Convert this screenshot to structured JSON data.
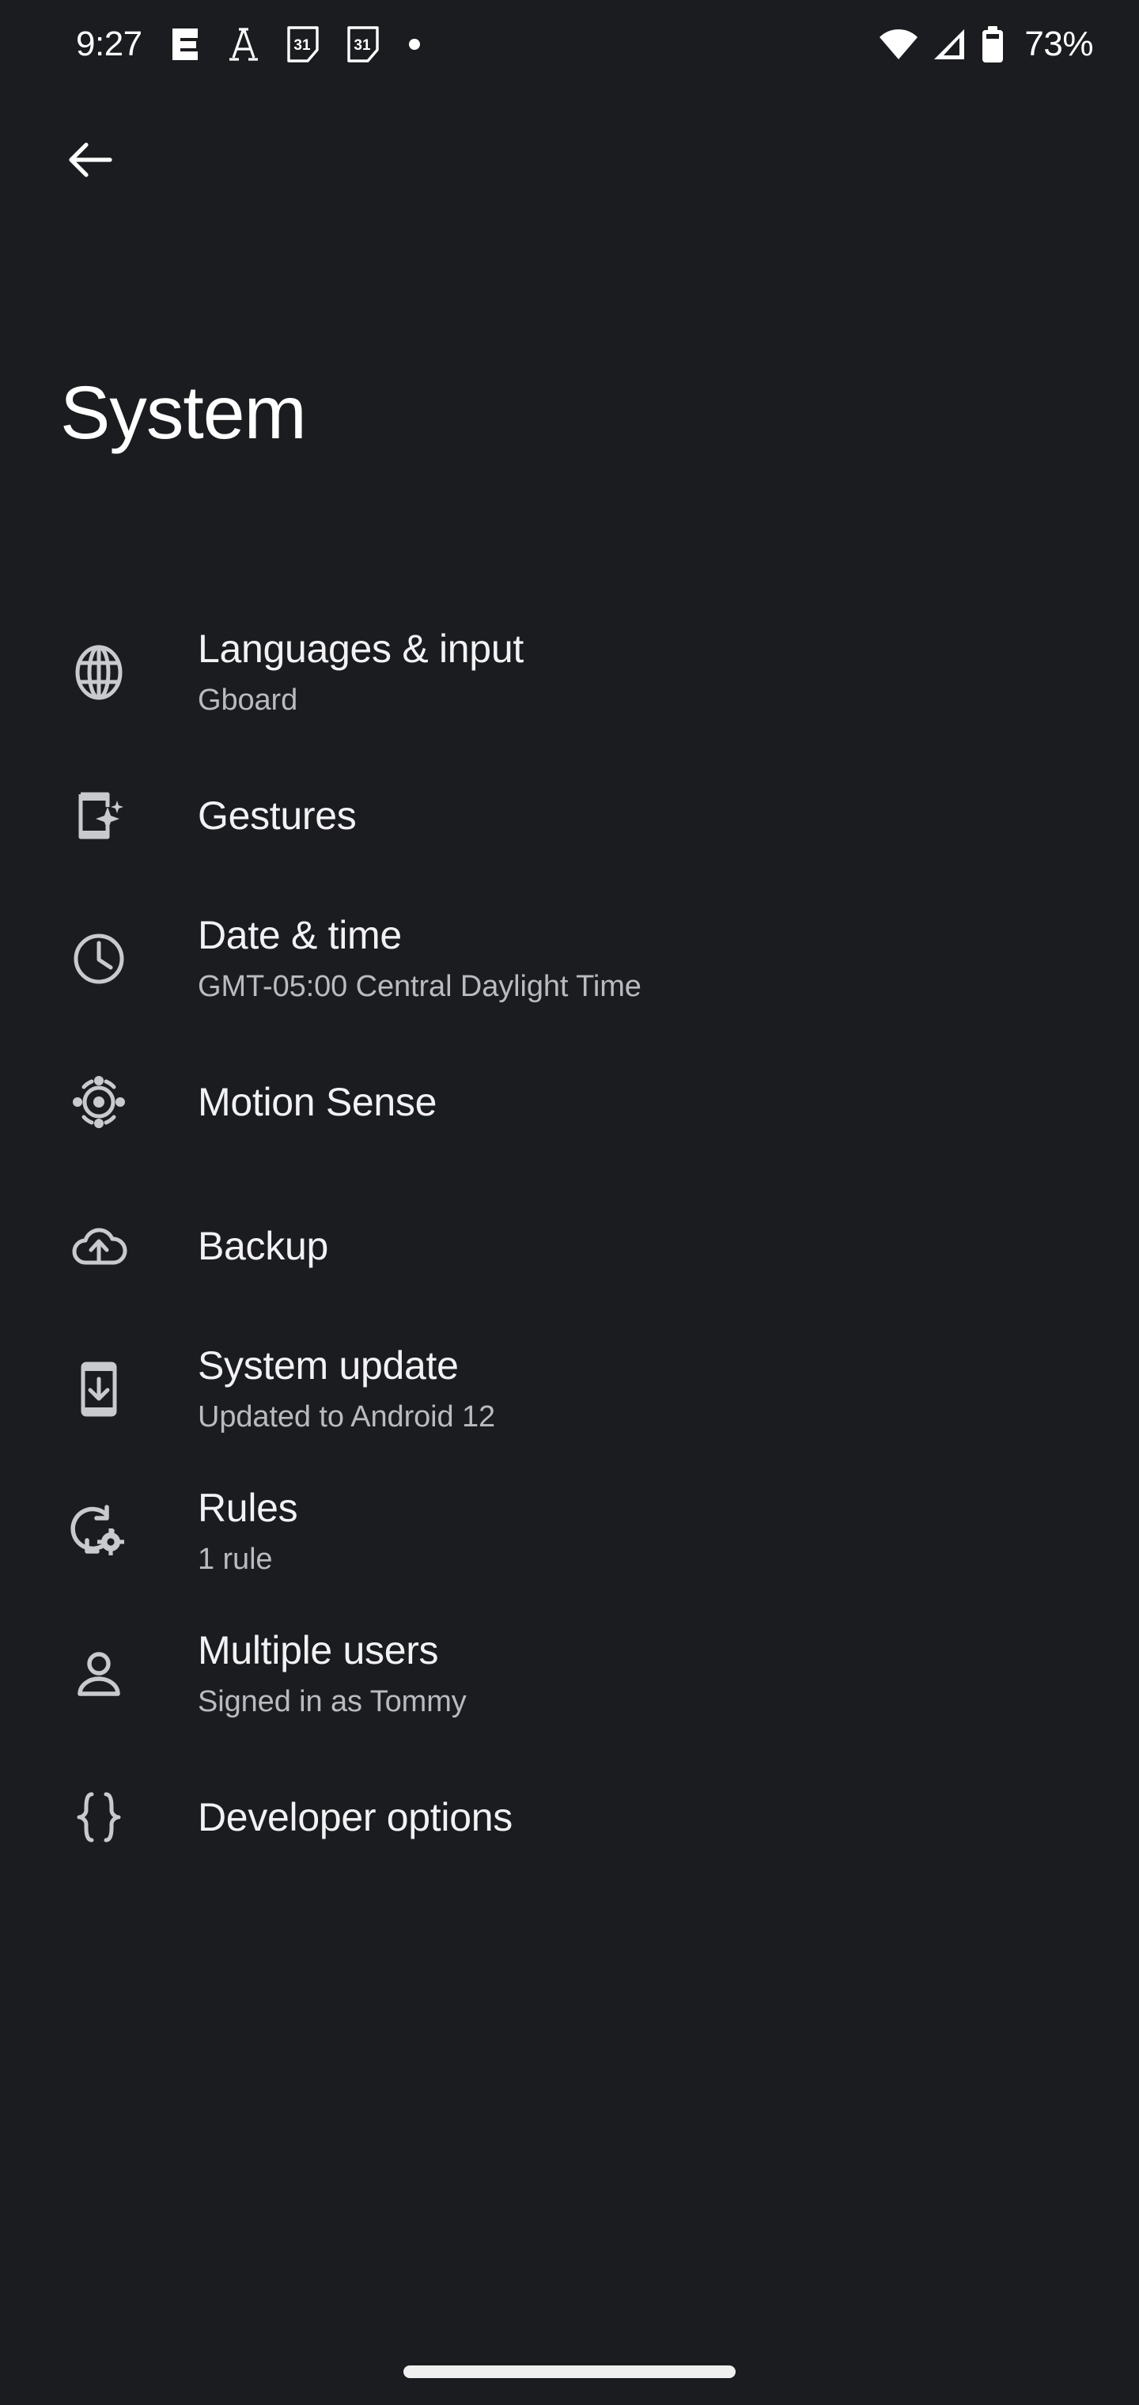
{
  "status_bar": {
    "clock": "9:27",
    "battery_percent": "73%",
    "left_icons": [
      {
        "name": "notification-e-icon",
        "label": "E"
      },
      {
        "name": "notification-font-a-icon",
        "label": "A"
      },
      {
        "name": "calendar-31-icon",
        "label": "31"
      },
      {
        "name": "calendar-31-icon-2",
        "label": "31"
      },
      {
        "name": "notification-dot-icon",
        "label": "•"
      }
    ],
    "right_icons": [
      {
        "name": "wifi-icon"
      },
      {
        "name": "cellular-signal-icon"
      },
      {
        "name": "battery-icon"
      }
    ]
  },
  "navigation": {
    "back_label": "Back",
    "back_icon": "arrow-left-icon"
  },
  "header": {
    "title": "System"
  },
  "list": {
    "items": [
      {
        "icon": "globe-icon",
        "title": "Languages & input",
        "subtitle": "Gboard"
      },
      {
        "icon": "gestures-phone-sparkle-icon",
        "title": "Gestures",
        "subtitle": ""
      },
      {
        "icon": "clock-icon",
        "title": "Date & time",
        "subtitle": "GMT-05:00 Central Daylight Time"
      },
      {
        "icon": "motion-sense-radar-icon",
        "title": "Motion Sense",
        "subtitle": ""
      },
      {
        "icon": "cloud-upload-icon",
        "title": "Backup",
        "subtitle": ""
      },
      {
        "icon": "system-update-phone-download-icon",
        "title": "System update",
        "subtitle": "Updated to Android 12"
      },
      {
        "icon": "rules-rotate-gear-icon",
        "title": "Rules",
        "subtitle": "1 rule"
      },
      {
        "icon": "person-icon",
        "title": "Multiple users",
        "subtitle": "Signed in as Tommy"
      },
      {
        "icon": "developer-braces-icon",
        "title": "Developer options",
        "subtitle": ""
      }
    ]
  },
  "system_nav": {
    "home_indicator": "home-gesture-bar"
  },
  "colors": {
    "background": "#1b1c20",
    "title_text": "#f2f2f4",
    "subtitle_text": "#b9bbc0",
    "icon": "#c9cace",
    "status_text": "#ffffff"
  }
}
